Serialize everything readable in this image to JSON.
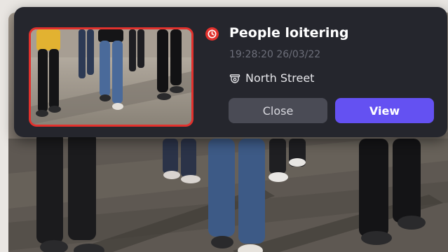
{
  "notification": {
    "title": "People loitering",
    "timestamp": "19:28:20 26/03/22",
    "location": "North Street",
    "alert_icon": "clock-alert-icon",
    "location_icon": "security-camera-icon",
    "alert_color": "#e2312d",
    "accent_color": "#6451f2"
  },
  "actions": {
    "close_label": "Close",
    "view_label": "View"
  }
}
